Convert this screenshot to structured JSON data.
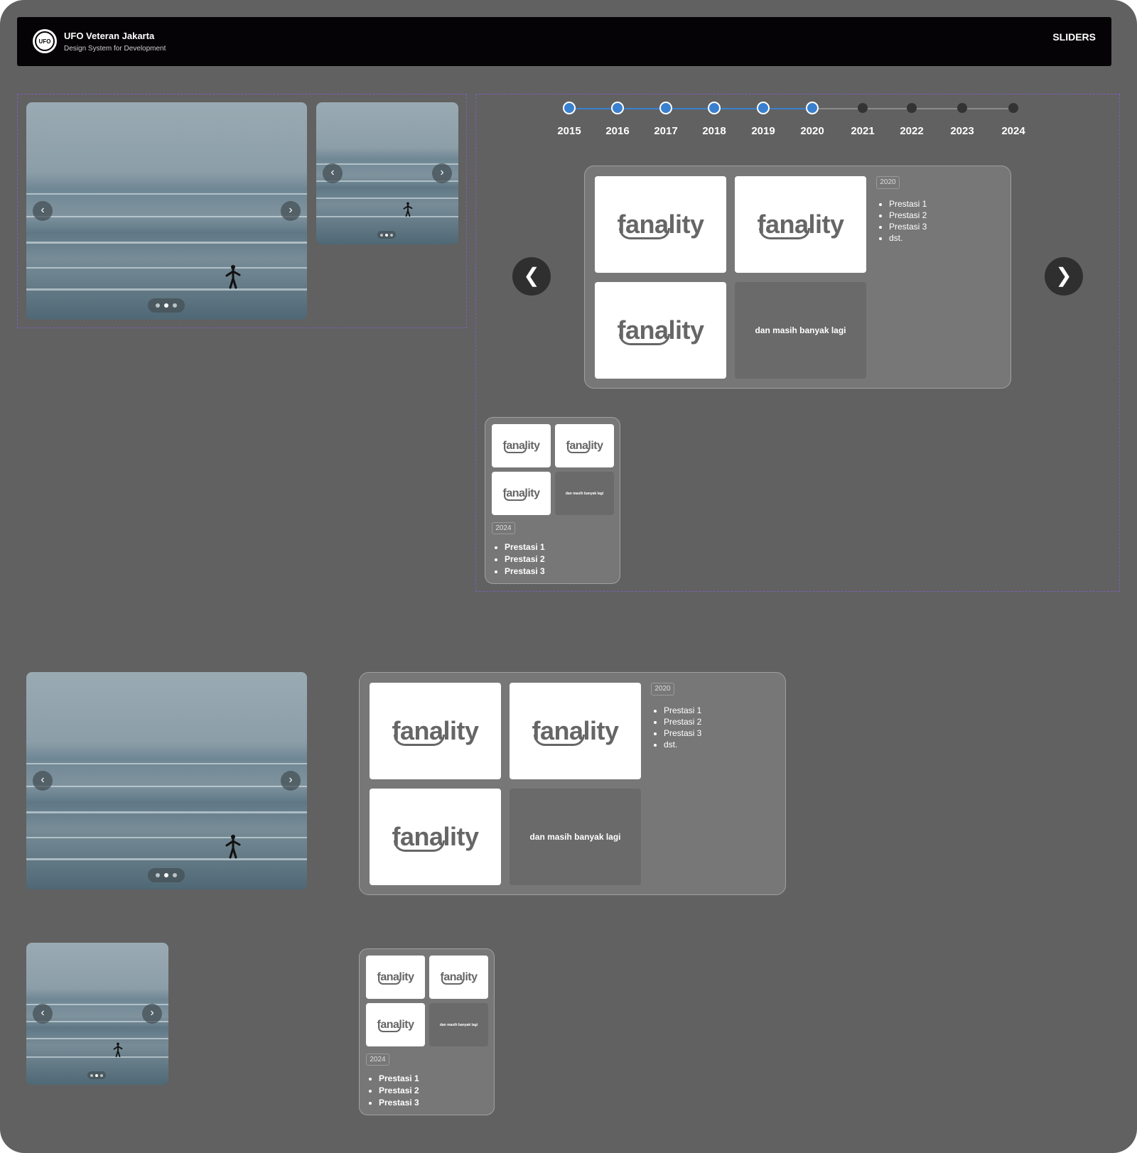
{
  "header": {
    "logo_text": "UFO",
    "title": "UFO Veteran Jakarta",
    "subtitle": "Design System for Development",
    "section": "SLIDERS"
  },
  "icons": {
    "prev": "‹",
    "next": "›",
    "prev_big": "❮",
    "next_big": "❯"
  },
  "timeline": {
    "years": [
      "2015",
      "2016",
      "2017",
      "2018",
      "2019",
      "2020",
      "2021",
      "2022",
      "2023",
      "2024"
    ],
    "active_up_to": "2020",
    "active_color": "#3a80d0",
    "inactive_color": "#333333"
  },
  "card_large": {
    "year": "2020",
    "brand": "fanality",
    "more_label": "dan masih banyak lagi",
    "achievements": [
      "Prestasi 1",
      "Prestasi 2",
      "Prestasi 3",
      "dst."
    ]
  },
  "card_small": {
    "year": "2024",
    "brand": "fanality",
    "more_label": "dan masih banyak lagi",
    "achievements": [
      "Prestasi 1",
      "Prestasi 2",
      "Prestasi 3"
    ]
  },
  "slider_dots": {
    "count": 3,
    "active_index": 1
  }
}
